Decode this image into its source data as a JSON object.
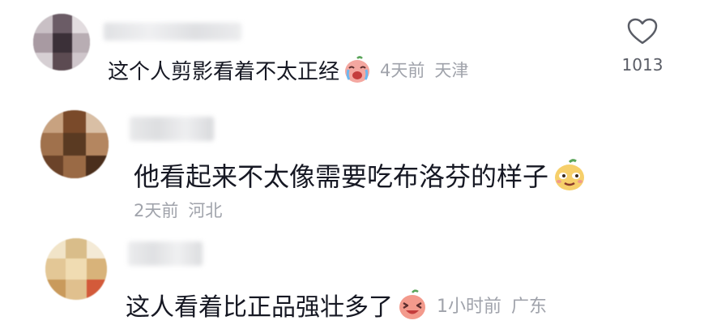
{
  "comments": [
    {
      "text": "这个人剪影看着不太正经",
      "emoji": "crying-laughing-emoji",
      "time": "4天前",
      "location": "天津",
      "like_count": "1013",
      "avatar_colors": [
        "#5c4b52",
        "#8a7d85",
        "#c9c0c5",
        "#3b3038",
        "#a89aa2",
        "#e2dcdf"
      ]
    },
    {
      "text": "他看起来不太像需要吃布洛芬的样子",
      "emoji": "smirk-emoji",
      "time": "2天前",
      "location": "河北"
    },
    {
      "text": "这人看着比正品强壮多了",
      "emoji": "laughing-emoji",
      "time": "1小时前",
      "location": "广东"
    }
  ],
  "colors": {
    "text": "#161823",
    "meta": "#a0a3ab",
    "like_icon": "#5a5d66"
  }
}
